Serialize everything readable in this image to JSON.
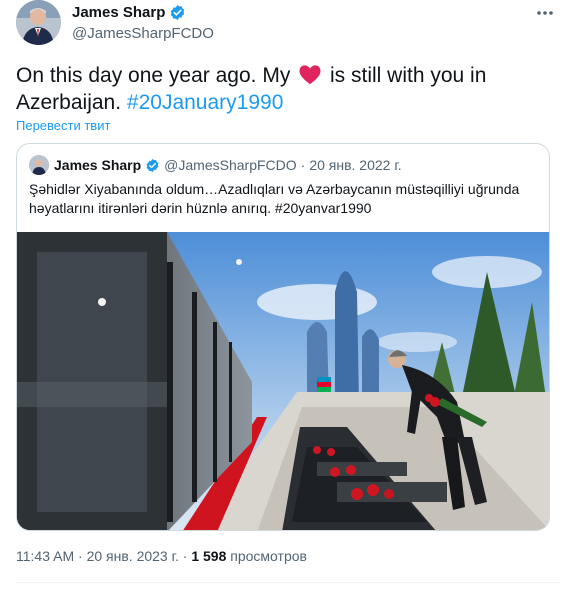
{
  "author": {
    "display_name": "James Sharp",
    "handle": "@JamesSharpFCDO"
  },
  "tweet": {
    "text_part1": "On this day one year ago. My",
    "text_part2": "is still with you in Azerbaijan.",
    "hashtag": "#20January1990",
    "translate_label": "Перевести твит"
  },
  "quoted": {
    "display_name": "James Sharp",
    "handle": "@JamesSharpFCDO",
    "separator": "·",
    "date": "20 янв. 2022 г.",
    "text": "Şəhidlər Xiyabanında oldum…Azadlıqları və Azərbaycanın müstəqilliyi uğrunda həyatlarını itirənləri dərin hüznlə anırıq. #20yanvar1990"
  },
  "meta": {
    "time": "11:43 AM",
    "sep1": "·",
    "date": "20 янв. 2023 г.",
    "sep2": "·",
    "views_count": "1 598",
    "views_label": "просмотров"
  },
  "colors": {
    "accent": "#1d9bf0",
    "heart": "#f91880",
    "text": "#0f1419",
    "muted": "#536471"
  },
  "icons": {
    "verified": "verified-badge-icon",
    "heart": "red-heart-emoji-icon",
    "more": "more-options-icon"
  }
}
